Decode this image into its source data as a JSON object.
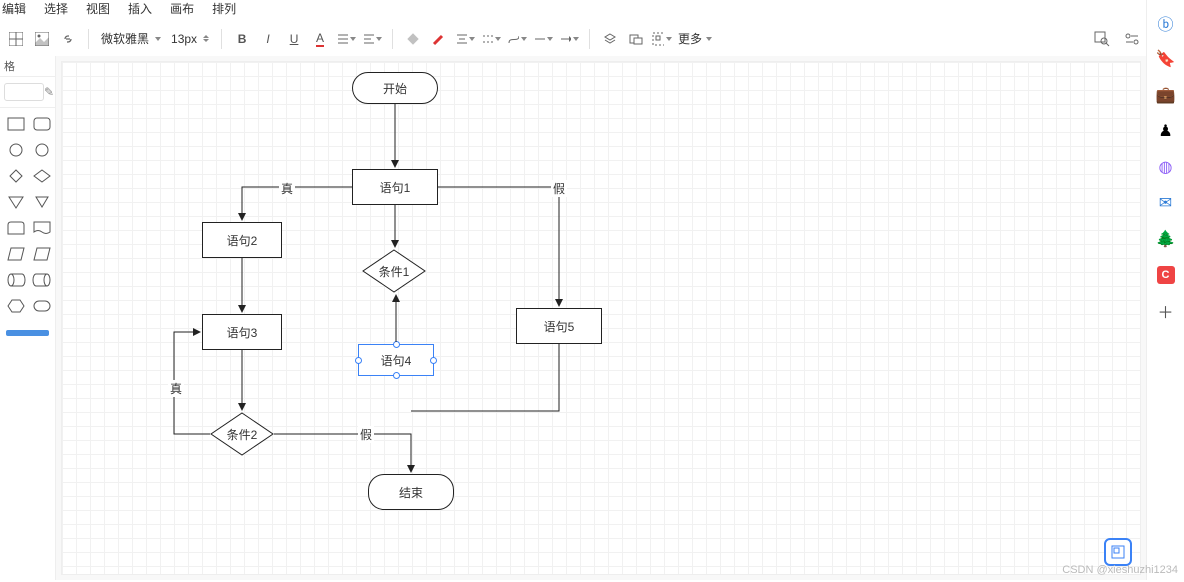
{
  "menu": {
    "items": [
      "编辑",
      "选择",
      "视图",
      "插入",
      "画布",
      "排列"
    ]
  },
  "toolbar": {
    "font_name": "微软雅黑",
    "font_size": "13px",
    "more_label": "更多"
  },
  "leftpanel": {
    "header": "格",
    "search_placeholder": ""
  },
  "flow": {
    "nodes": {
      "start": "开始",
      "stmt1": "语句1",
      "stmt2": "语句2",
      "stmt3": "语句3",
      "stmt4": "语句4",
      "stmt5": "语句5",
      "cond1": "条件1",
      "cond2": "条件2",
      "end": "结束"
    },
    "edge_labels": {
      "true1": "真",
      "false1": "假",
      "true2": "真",
      "false2": "假"
    }
  },
  "watermark": "CSDN @xieshuzhi1234",
  "chart_data": {
    "type": "flowchart",
    "nodes": [
      {
        "id": "start",
        "label": "开始",
        "shape": "terminator"
      },
      {
        "id": "stmt1",
        "label": "语句1",
        "shape": "process"
      },
      {
        "id": "cond1",
        "label": "条件1",
        "shape": "decision"
      },
      {
        "id": "stmt2",
        "label": "语句2",
        "shape": "process"
      },
      {
        "id": "stmt3",
        "label": "语句3",
        "shape": "process"
      },
      {
        "id": "stmt4",
        "label": "语句4",
        "shape": "process"
      },
      {
        "id": "stmt5",
        "label": "语句5",
        "shape": "process"
      },
      {
        "id": "cond2",
        "label": "条件2",
        "shape": "decision"
      },
      {
        "id": "end",
        "label": "结束",
        "shape": "terminator"
      }
    ],
    "edges": [
      {
        "from": "start",
        "to": "stmt1"
      },
      {
        "from": "stmt1",
        "to": "stmt2",
        "label": "真"
      },
      {
        "from": "stmt1",
        "to": "stmt5",
        "label": "假"
      },
      {
        "from": "stmt1",
        "to": "cond1"
      },
      {
        "from": "cond1",
        "to": "stmt4"
      },
      {
        "from": "stmt4",
        "to": "cond1"
      },
      {
        "from": "stmt2",
        "to": "stmt3"
      },
      {
        "from": "stmt3",
        "to": "cond2"
      },
      {
        "from": "cond2",
        "to": "stmt3",
        "label": "真"
      },
      {
        "from": "cond2",
        "to": "end",
        "label": "假"
      },
      {
        "from": "stmt5",
        "to": "end"
      }
    ]
  }
}
